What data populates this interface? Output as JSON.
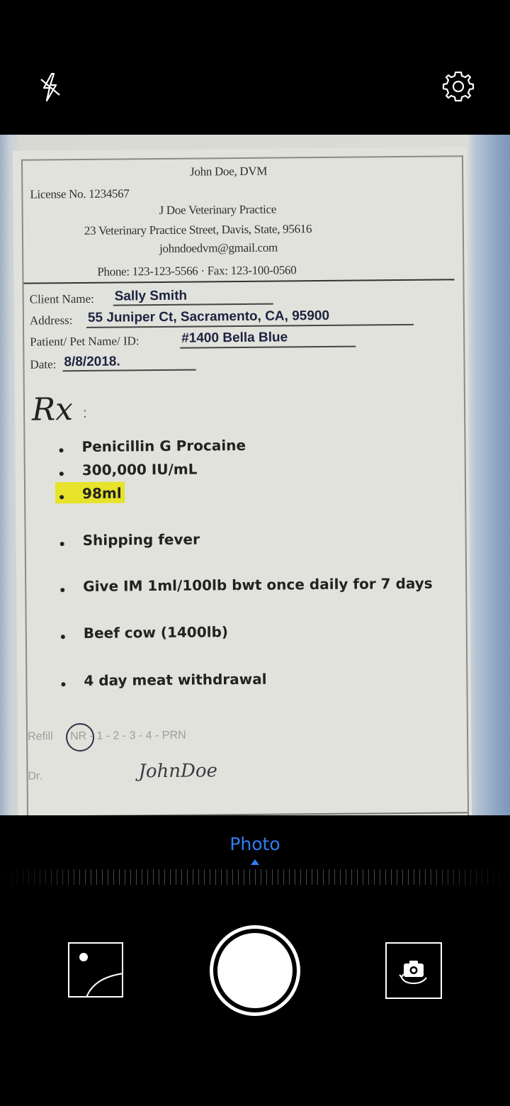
{
  "camera": {
    "mode_label": "Photo",
    "flash_icon": "flash-off-icon",
    "settings_icon": "gear-icon",
    "gallery_icon": "gallery-thumbnail-icon",
    "switch_icon": "switch-camera-icon",
    "accent_color": "#2e7df6"
  },
  "document": {
    "doctor": "John Doe, DVM",
    "license": "License No. 1234567",
    "practice": "J Doe Veterinary Practice",
    "address": "23 Veterinary Practice Street, Davis, State, 95616",
    "email": "johndoedvm@gmail.com",
    "phone_fax": "Phone: 123-123-5566  ·  Fax: 123-100-0560",
    "client_label": "Client Name:",
    "client_value": "Sally Smith",
    "address_label": "Address:",
    "address_value": "55 Juniper Ct, Sacramento, CA, 95900",
    "patient_label": "Patient/ Pet Name/ ID:",
    "patient_value": "#1400 Bella Blue",
    "date_label": "Date:",
    "date_value": "8/8/2018.",
    "rx": "Rx",
    "rx_colon": ":",
    "items": [
      "Penicillin G Procaine",
      "300,000 IU/mL",
      "98ml",
      "Shipping fever",
      "Give IM 1ml/100lb bwt once daily for 7 days",
      "Beef cow (1400lb)",
      "4 day meat withdrawal"
    ],
    "highlight_color": "#e6e32a",
    "refill_label": "Refill",
    "refill_options": "NR - 1 - 2 - 3 - 4 - PRN",
    "dr_label": "Dr.",
    "signature": "JohnDoe"
  }
}
